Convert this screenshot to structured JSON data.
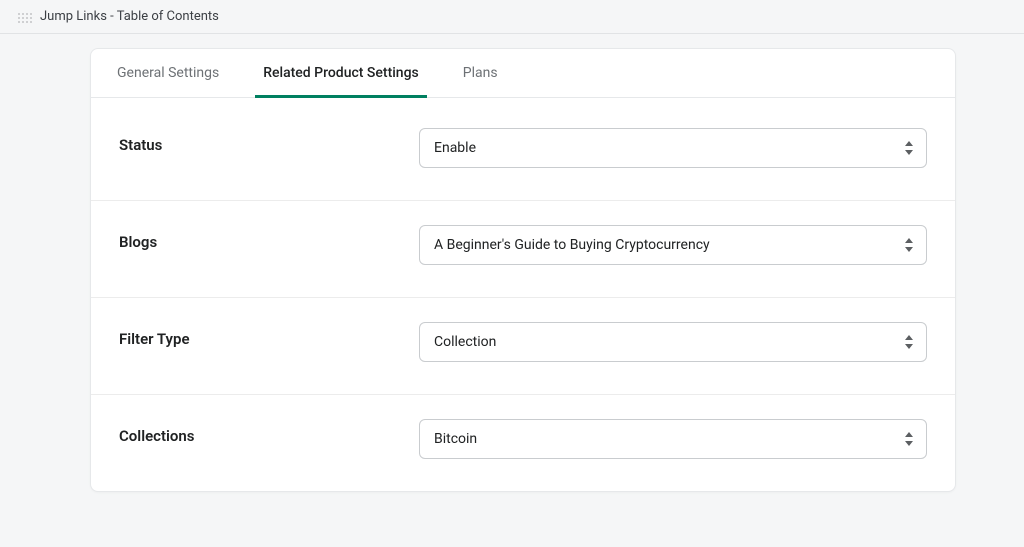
{
  "header": {
    "title": "Jump Links - Table of Contents"
  },
  "tabs": [
    {
      "label": "General Settings",
      "active": false
    },
    {
      "label": "Related Product Settings",
      "active": true
    },
    {
      "label": "Plans",
      "active": false
    }
  ],
  "fields": {
    "status": {
      "label": "Status",
      "value": "Enable"
    },
    "blogs": {
      "label": "Blogs",
      "value": "A Beginner's Guide to Buying Cryptocurrency"
    },
    "filter_type": {
      "label": "Filter Type",
      "value": "Collection"
    },
    "collections": {
      "label": "Collections",
      "value": "Bitcoin"
    }
  }
}
